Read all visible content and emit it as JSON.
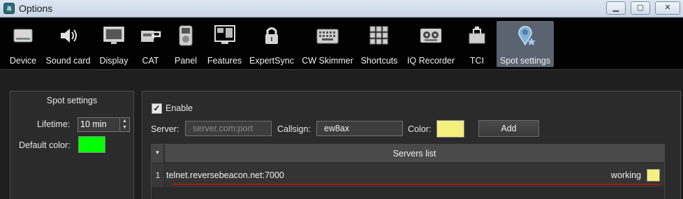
{
  "window": {
    "title": "Options",
    "buttons": {
      "minimize": "▁",
      "maximize": "▢",
      "close": "✕"
    }
  },
  "toolbar": {
    "items": [
      {
        "label": "Device",
        "icon": "device-icon"
      },
      {
        "label": "Sound card",
        "icon": "speaker-icon"
      },
      {
        "label": "Display",
        "icon": "monitor-icon"
      },
      {
        "label": "CAT",
        "icon": "cat-icon"
      },
      {
        "label": "Panel",
        "icon": "panel-icon"
      },
      {
        "label": "Features",
        "icon": "features-icon"
      },
      {
        "label": "ExpertSync",
        "icon": "lock-icon"
      },
      {
        "label": "CW Skimmer",
        "icon": "keyboard-icon"
      },
      {
        "label": "Shortcuts",
        "icon": "grid-icon"
      },
      {
        "label": "IQ Recorder",
        "icon": "tape-icon"
      },
      {
        "label": "TCI",
        "icon": "tci-icon"
      },
      {
        "label": "Spot settings",
        "icon": "map-pin-icon",
        "active": true
      }
    ]
  },
  "spot_panel": {
    "title": "Spot settings",
    "lifetime_label": "Lifetime:",
    "lifetime_value": "10 min",
    "default_color_label": "Default color:",
    "default_color": "#00ff00"
  },
  "server_panel": {
    "enable_label": "Enable",
    "enable_checked": true,
    "server_label": "Server:",
    "server_placeholder": "server.com:port",
    "callsign_label": "Callsign:",
    "callsign_value": "ew8ax",
    "color_label": "Color:",
    "color": "#f3f07e",
    "add_label": "Add",
    "table": {
      "header": "Servers list",
      "rows": [
        {
          "num": "1",
          "host": "telnet.reversebeacon.net:7000",
          "status": "working",
          "color": "#f3f07e"
        }
      ]
    }
  }
}
